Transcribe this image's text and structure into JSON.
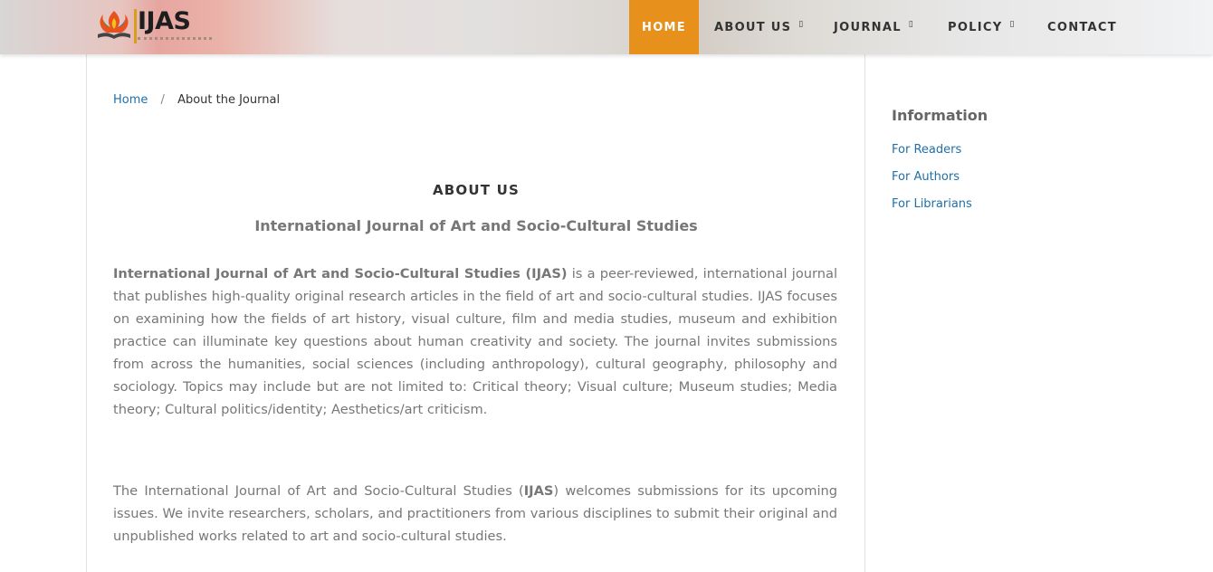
{
  "header": {
    "logo_text": "IJAS",
    "nav": [
      {
        "label": "HOME",
        "active": true
      },
      {
        "label": "ABOUT US",
        "dropdown": true
      },
      {
        "label": "JOURNAL",
        "dropdown": true
      },
      {
        "label": "POLICY",
        "dropdown": true
      },
      {
        "label": "CONTACT"
      }
    ],
    "caret_glyph": "▯"
  },
  "breadcrumb": {
    "home": "Home",
    "separator": "/",
    "current": "About the Journal"
  },
  "main": {
    "title": "ABOUT US",
    "subtitle": "International Journal of Art and Socio-Cultural Studies",
    "p1_bold": "International Journal of Art and Socio-Cultural Studies (IJAS)",
    "p1_rest": " is a peer-reviewed, international journal that publishes high-quality original research articles in the field of art and socio-cultural studies. IJAS focuses on examining how the fields of art history, visual culture, film and media studies, museum and exhibition practice can illuminate key questions about human creativity and society. The journal invites submissions from across the humanities, social sciences (including anthropology), cultural geography, philosophy and sociology. Topics may include but are not limited to: Critical theory; Visual culture; Museum studies; Media theory; Cultural politics/identity; Aesthetics/art criticism.",
    "p2_a": "The International Journal of Art and Socio-Cultural Studies (",
    "p2_bold": "IJAS",
    "p2_b": ") welcomes submissions for its upcoming issues. We invite researchers, scholars, and practitioners from various disciplines to submit their original and unpublished works related to art and socio-cultural studies."
  },
  "sidebar": {
    "title": "Information",
    "links": [
      "For Readers",
      "For Authors",
      "For Librarians"
    ]
  },
  "colors": {
    "accent": "#e7901b",
    "link": "#1f6fa8"
  }
}
